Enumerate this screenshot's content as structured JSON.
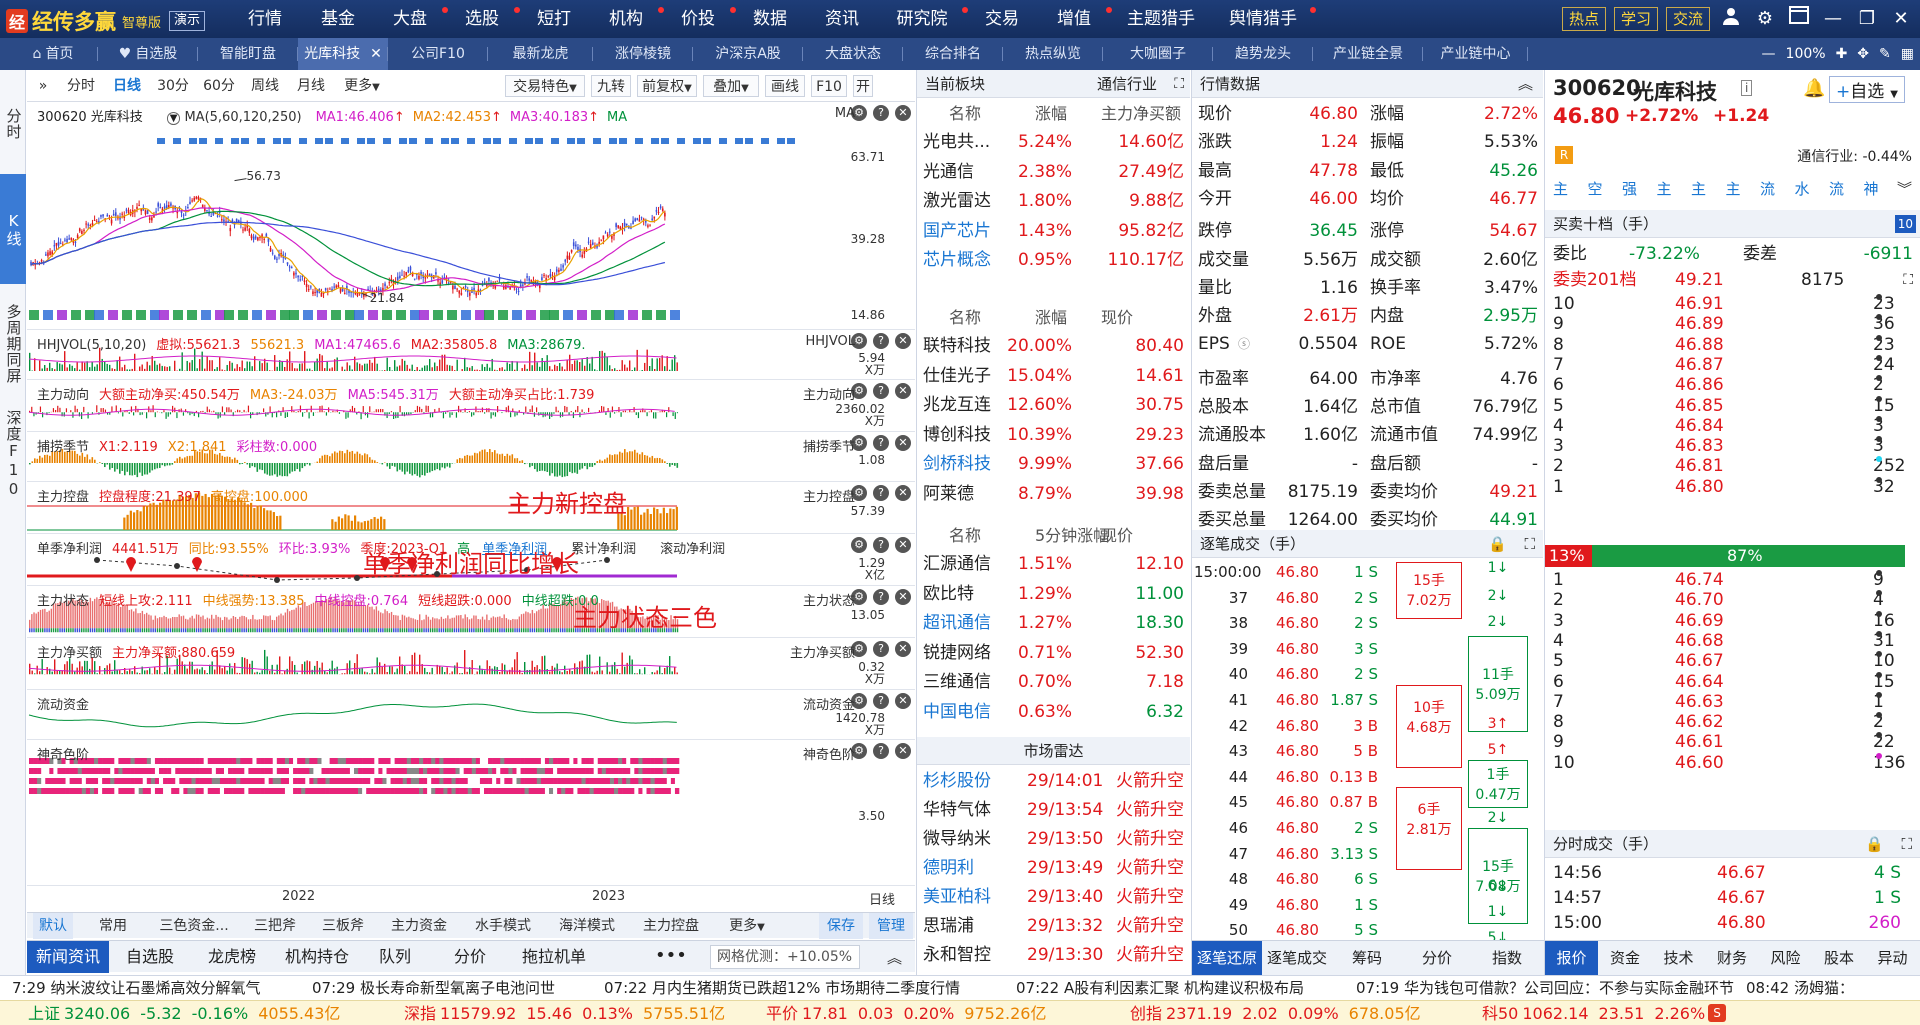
{
  "app": {
    "brand": "经传多赢",
    "edition": "智尊版",
    "demo": "演示"
  },
  "top_menu": [
    {
      "label": "行情",
      "dot": false
    },
    {
      "label": "基金",
      "dot": false
    },
    {
      "label": "大盘",
      "dot": true
    },
    {
      "label": "选股",
      "dot": true
    },
    {
      "label": "短打",
      "dot": false
    },
    {
      "label": "机构",
      "dot": true
    },
    {
      "label": "价投",
      "dot": true
    },
    {
      "label": "数据",
      "dot": false
    },
    {
      "label": "资讯",
      "dot": false
    },
    {
      "label": "研究院",
      "dot": true
    },
    {
      "label": "交易",
      "dot": false
    },
    {
      "label": "增值",
      "dot": true
    },
    {
      "label": "主题猎手",
      "dot": false
    },
    {
      "label": "舆情猎手",
      "dot": true
    }
  ],
  "top_buttons": [
    "热点",
    "学习",
    "交流"
  ],
  "tabs": [
    "首页",
    "自选股",
    "智能盯盘",
    "光库科技",
    "公司F10",
    "最新龙虎",
    "涨停棱镜",
    "沪深京A股",
    "大盘状态",
    "综合排名",
    "热点纵览",
    "大咖圈子",
    "趋势龙头",
    "产业链全景",
    "产业链中心"
  ],
  "zoom": "100%",
  "vtabs": [
    "分时",
    "K线",
    "多周期同屏",
    "深度F10"
  ],
  "chart_toolbar": {
    "periods": [
      "分时",
      "日线",
      "30分",
      "60分",
      "周线",
      "月线",
      "更多"
    ],
    "tools": [
      "交易特色",
      "九转",
      "前复权",
      "叠加",
      "画线",
      "F10",
      "开"
    ]
  },
  "panes": [
    {
      "name": "main",
      "code": "300620 光库科技",
      "ma_title": "MA(5,60,120,250)",
      "ma1": "MA1:46.406",
      "ma2": "MA2:42.453",
      "ma3": "MA3:40.183",
      "ma4": "MA",
      "right": "MA",
      "y": [
        "63.71",
        "39.28",
        "14.86"
      ],
      "high": "56.73",
      "low": "21.84"
    },
    {
      "name": "hhjvol",
      "title": "HHJVOL(5,10,20)",
      "v1": "虚拟:55621.3",
      "v2": "55621.3",
      "v3": "MA1:47465.6",
      "v4": "MA2:35805.8",
      "v5": "MA3:28679.",
      "right": "HHJVOL",
      "y1": "5.94",
      "y2": "X万"
    },
    {
      "name": "zldx",
      "title": "主力动向",
      "v1": "大额主动净买:450.54万",
      "v2": "MA3:-24.03万",
      "v3": "MA5:545.31万",
      "v4": "大额主动净买占比:1.739",
      "right": "主力动向",
      "y1": "2360.02",
      "y2": "X万"
    },
    {
      "name": "blj",
      "title": "捕捞季节",
      "v1": "X1:2.119",
      "v2": "X2:1.841",
      "v3": "彩柱数:0.000",
      "right": "捕捞季节",
      "y1": "1.08"
    },
    {
      "name": "zlkp",
      "title": "主力控盘",
      "v1": "控盘程度:21.397",
      "v2": "高控盘:100.000",
      "right": "主力控盘",
      "y1": "57.39",
      "annot": "主力新控盘"
    },
    {
      "name": "dj",
      "title": "单季净利润",
      "v1": "4441.51万",
      "v2": "同比:93.55%",
      "v3": "环比:3.93%",
      "v4": "季度:2023-Q1",
      "v5": "高",
      "t1": "单季净利润",
      "t2": "累计净利润",
      "t3": "滚动净利润",
      "y1": "1.29",
      "y2": "X亿",
      "annot": "单季净利润同比增长"
    },
    {
      "name": "zlzt",
      "title": "主力状态",
      "v1": "短线上攻:2.111",
      "v2": "中线强势:13.385",
      "v3": "中线控盘:0.764",
      "v4": "短线超跌:0.000",
      "v5": "中线超跌:0.0",
      "right": "主力状态",
      "y1": "13.05",
      "annot": "主力状态三色"
    },
    {
      "name": "zljme",
      "title": "主力净买额",
      "v1": "主力净买额:880.659",
      "right": "主力净买额",
      "y1": "0.32",
      "y2": "X万"
    },
    {
      "name": "ldzj",
      "title": "流动资金",
      "right": "流动资金",
      "y1": "1420.78",
      "y2": "X万"
    },
    {
      "name": "sqsj",
      "title": "神奇色阶",
      "right": "神奇色阶",
      "y1": "3.50"
    }
  ],
  "xaxis": [
    "2022",
    "2023",
    "日线"
  ],
  "bottom_tabs": [
    "默认",
    "常用",
    "三色资金...",
    "三把斧",
    "三板斧",
    "主力资金",
    "水手模式",
    "海洋模式",
    "主力控盘",
    "更多",
    "保存",
    "管理"
  ],
  "bottom_nav": [
    "新闻资讯",
    "自选股",
    "龙虎榜",
    "机构持仓",
    "队列",
    "分价",
    "拖拉机单"
  ],
  "net_opt": "网格优测：+10.05%",
  "sector": {
    "title": "当前板块",
    "industry": "通信行业",
    "h1": [
      "名称",
      "涨幅",
      "主力净买额"
    ],
    "list1": [
      {
        "n": "光电共...",
        "c": "5.24%",
        "v": "14.60亿",
        "blue": false
      },
      {
        "n": "光通信",
        "c": "2.38%",
        "v": "27.49亿",
        "blue": false
      },
      {
        "n": "激光雷达",
        "c": "1.80%",
        "v": "9.88亿",
        "blue": false
      },
      {
        "n": "国产芯片",
        "c": "1.43%",
        "v": "95.82亿",
        "blue": true
      },
      {
        "n": "芯片概念",
        "c": "0.95%",
        "v": "110.17亿",
        "blue": true
      }
    ],
    "h2": [
      "名称",
      "涨幅",
      "现价"
    ],
    "list2": [
      {
        "n": "联特科技",
        "c": "20.00%",
        "v": "80.40",
        "blue": false
      },
      {
        "n": "仕佳光子",
        "c": "15.04%",
        "v": "14.61",
        "blue": false
      },
      {
        "n": "兆龙互连",
        "c": "12.60%",
        "v": "30.75",
        "blue": false
      },
      {
        "n": "博创科技",
        "c": "10.39%",
        "v": "29.23",
        "blue": false
      },
      {
        "n": "剑桥科技",
        "c": "9.99%",
        "v": "37.66",
        "blue": true
      },
      {
        "n": "阿莱德",
        "c": "8.79%",
        "v": "39.98",
        "blue": false
      }
    ],
    "h3": [
      "名称",
      "5分钟涨幅",
      "现价"
    ],
    "list3": [
      {
        "n": "汇源通信",
        "c": "1.51%",
        "v": "12.10",
        "blue": false
      },
      {
        "n": "欧比特",
        "c": "1.29%",
        "v": "11.00",
        "blue": false
      },
      {
        "n": "超讯通信",
        "c": "1.27%",
        "v": "18.30",
        "blue": true
      },
      {
        "n": "锐捷网络",
        "c": "0.71%",
        "v": "52.30",
        "blue": false
      },
      {
        "n": "三维通信",
        "c": "0.70%",
        "v": "7.18",
        "blue": false
      },
      {
        "n": "中国电信",
        "c": "0.63%",
        "v": "6.32",
        "blue": true
      }
    ],
    "radar_title": "市场雷达",
    "radar": [
      {
        "n": "杉杉股份",
        "t": "29/14:01",
        "e": "火箭升空",
        "blue": true
      },
      {
        "n": "华特气体",
        "t": "29/13:54",
        "e": "火箭升空",
        "blue": false
      },
      {
        "n": "微导纳米",
        "t": "29/13:50",
        "e": "火箭升空",
        "blue": false
      },
      {
        "n": "德明利",
        "t": "29/13:49",
        "e": "火箭升空",
        "blue": true
      },
      {
        "n": "美亚柏科",
        "t": "29/13:40",
        "e": "火箭升空",
        "blue": true
      },
      {
        "n": "思瑞浦",
        "t": "29/13:32",
        "e": "火箭升空",
        "blue": false
      },
      {
        "n": "永和智控",
        "t": "29/13:30",
        "e": "火箭升空",
        "blue": false
      }
    ]
  },
  "market": {
    "title": "行情数据",
    "rows": [
      {
        "l1": "现价",
        "v1": "46.80",
        "c1": "red",
        "l2": "涨幅",
        "v2": "2.72%",
        "c2": "red"
      },
      {
        "l1": "涨跌",
        "v1": "1.24",
        "c1": "red",
        "l2": "振幅",
        "v2": "5.53%",
        "c2": ""
      },
      {
        "l1": "最高",
        "v1": "47.78",
        "c1": "red",
        "l2": "最低",
        "v2": "45.26",
        "c2": "grn"
      },
      {
        "l1": "今开",
        "v1": "46.00",
        "c1": "red",
        "l2": "均价",
        "v2": "46.77",
        "c2": "red"
      },
      {
        "l1": "跌停",
        "v1": "36.45",
        "c1": "grn",
        "l2": "涨停",
        "v2": "54.67",
        "c2": "red"
      },
      {
        "l1": "成交量",
        "v1": "5.56万",
        "c1": "",
        "l2": "成交额",
        "v2": "2.60亿",
        "c2": ""
      },
      {
        "l1": "量比",
        "v1": "1.16",
        "c1": "",
        "l2": "换手率",
        "v2": "3.47%",
        "c2": ""
      },
      {
        "l1": "外盘",
        "v1": "2.61万",
        "c1": "red",
        "l2": "内盘",
        "v2": "2.95万",
        "c2": "grn"
      },
      {
        "l1": "EPS",
        "v1": "0.5504",
        "c1": "",
        "l2": "ROE",
        "v2": "5.72%",
        "c2": ""
      },
      {
        "l1": "市盈率",
        "v1": "64.00",
        "c1": "",
        "l2": "市净率",
        "v2": "4.76",
        "c2": ""
      },
      {
        "l1": "总股本",
        "v1": "1.64亿",
        "c1": "",
        "l2": "总市值",
        "v2": "76.79亿",
        "c2": ""
      },
      {
        "l1": "流通股本",
        "v1": "1.60亿",
        "c1": "",
        "l2": "流通市值",
        "v2": "74.99亿",
        "c2": ""
      },
      {
        "l1": "盘后量",
        "v1": "-",
        "c1": "",
        "l2": "盘后额",
        "v2": "-",
        "c2": ""
      },
      {
        "l1": "委卖总量",
        "v1": "8175.19",
        "c1": "",
        "l2": "委卖均价",
        "v2": "49.21",
        "c2": "red"
      },
      {
        "l1": "委买总量",
        "v1": "1264.00",
        "c1": "",
        "l2": "委买均价",
        "v2": "44.91",
        "c2": "grn"
      }
    ],
    "ticks_title": "逐笔成交（手）",
    "ticks": [
      {
        "t": "15:00:00",
        "p": "46.80",
        "v": "1 S"
      },
      {
        "t": "37",
        "p": "46.80",
        "v": "2 S"
      },
      {
        "t": "38",
        "p": "46.80",
        "v": "2 S"
      },
      {
        "t": "39",
        "p": "46.80",
        "v": "3 S"
      },
      {
        "t": "40",
        "p": "46.80",
        "v": "2 S"
      },
      {
        "t": "41",
        "p": "46.80",
        "v": "1.87 S"
      },
      {
        "t": "42",
        "p": "46.80",
        "v": "3 B"
      },
      {
        "t": "43",
        "p": "46.80",
        "v": "5 B"
      },
      {
        "t": "44",
        "p": "46.80",
        "v": "0.13 B"
      },
      {
        "t": "45",
        "p": "46.80",
        "v": "0.87 B"
      },
      {
        "t": "46",
        "p": "46.80",
        "v": "2 S"
      },
      {
        "t": "47",
        "p": "46.80",
        "v": "3.13 S"
      },
      {
        "t": "48",
        "p": "46.80",
        "v": "6 S"
      },
      {
        "t": "49",
        "p": "46.80",
        "v": "1 S"
      },
      {
        "t": "50",
        "p": "46.80",
        "v": "5 S"
      }
    ],
    "boxes_left": [
      {
        "a": "15手",
        "b": "7.02万"
      },
      {
        "a": "10手",
        "b": "4.68万"
      },
      {
        "a": "6手",
        "b": "2.81万"
      }
    ],
    "boxes_right": [
      {
        "a": "1",
        "c": "grn"
      },
      {
        "a": "2",
        "c": "grn"
      },
      {
        "a": "2",
        "c": "grn"
      },
      {
        "a": "11手",
        "b": "5.09万",
        "c": "grn"
      },
      {
        "a": "3",
        "c": "red"
      },
      {
        "a": "5",
        "c": "red"
      },
      {
        "a": "1手",
        "b": "0.47万",
        "c": "grn"
      },
      {
        "a": "2",
        "c": "grn"
      },
      {
        "a": "15手",
        "b": "7.08万",
        "c": "grn"
      },
      {
        "a": "6",
        "c": "grn"
      },
      {
        "a": "1",
        "c": "grn"
      },
      {
        "a": "5",
        "c": "grn"
      }
    ],
    "nav": [
      "逐笔还原",
      "逐笔成交",
      "筹码",
      "分价",
      "指数"
    ]
  },
  "book": {
    "code": "300620",
    "name": "光库科技",
    "price": "46.80",
    "pct": "+2.72%",
    "chg": "+1.24",
    "industry": "通信行业: -0.44%",
    "add": "自选",
    "signals": [
      "主",
      "空",
      "强",
      "主",
      "主",
      "主",
      "流",
      "水",
      "流",
      "神"
    ],
    "title": "买卖十档（手）",
    "badge": "10",
    "wb_l": "委比",
    "wb": "-73.22%",
    "wc_l": "委差",
    "wc": "-6911",
    "sell201_l": "委卖201档",
    "sell201_p": "49.21",
    "sell201_v": "8175",
    "asks": [
      {
        "n": "10",
        "p": "46.91",
        "v": "23",
        "d": "#333"
      },
      {
        "n": "9",
        "p": "46.89",
        "v": "36",
        "d": "#333"
      },
      {
        "n": "8",
        "p": "46.88",
        "v": "23",
        "d": "#333"
      },
      {
        "n": "7",
        "p": "46.87",
        "v": "24",
        "d": "#333"
      },
      {
        "n": "6",
        "p": "46.86",
        "v": "2",
        "d": "#333"
      },
      {
        "n": "5",
        "p": "46.85",
        "v": "15",
        "d": "#333"
      },
      {
        "n": "4",
        "p": "46.84",
        "v": "3",
        "d": "#333"
      },
      {
        "n": "3",
        "p": "46.83",
        "v": "3",
        "d": "#333"
      },
      {
        "n": "2",
        "p": "46.81",
        "v": "252",
        "d": "#21d4f0"
      },
      {
        "n": "1",
        "p": "46.80",
        "v": "32",
        "d": "#333"
      }
    ],
    "ratio_sell": "13%",
    "ratio_buy": "87%",
    "ratio_sell_frac": 0.13,
    "bids": [
      {
        "n": "1",
        "p": "46.74",
        "v": "9",
        "d": "#333"
      },
      {
        "n": "2",
        "p": "46.70",
        "v": "4",
        "d": "#333"
      },
      {
        "n": "3",
        "p": "46.69",
        "v": "16",
        "d": "#333"
      },
      {
        "n": "4",
        "p": "46.68",
        "v": "31",
        "d": "#333"
      },
      {
        "n": "5",
        "p": "46.67",
        "v": "10",
        "d": "#333"
      },
      {
        "n": "6",
        "p": "46.64",
        "v": "15",
        "d": "#333"
      },
      {
        "n": "7",
        "p": "46.63",
        "v": "1",
        "d": "#333"
      },
      {
        "n": "8",
        "p": "46.62",
        "v": "2",
        "d": "#333"
      },
      {
        "n": "9",
        "p": "46.61",
        "v": "22",
        "d": "#333"
      },
      {
        "n": "10",
        "p": "46.60",
        "v": "136",
        "d": "#d21ec8"
      }
    ],
    "time_title": "分时成交（手）",
    "time": [
      {
        "t": "14:56",
        "p": "46.67",
        "v": "4 S"
      },
      {
        "t": "14:57",
        "p": "46.67",
        "v": "1 S"
      },
      {
        "t": "15:00",
        "p": "46.80",
        "v": "260"
      }
    ],
    "nav": [
      "报价",
      "资金",
      "技术",
      "财务",
      "风险",
      "股本",
      "异动"
    ]
  },
  "news": [
    "7:29 纳米波纹让石墨烯高效分解氧气",
    "07:29 极长寿命新型氧离子电池问世",
    "07:22 月内生猪期货已跌超12% 市场期待二季度行情",
    "07:22 A股有利因素汇聚 机构建议积极布局",
    "07:19 华为钱包可借款？公司回应：不参与实际金融环节",
    "08:42 汤姆猫："
  ],
  "indices": [
    {
      "n": "上证",
      "v": "3240.06",
      "c": "-5.32",
      "p": "-0.16%",
      "a": "4055.43亿",
      "col": "grn"
    },
    {
      "n": "深指",
      "v": "11579.92",
      "c": "15.46",
      "p": "0.13%",
      "a": "5755.51亿",
      "col": "red"
    },
    {
      "n": "平价",
      "v": "17.81",
      "c": "0.03",
      "p": "0.20%",
      "a": "9752.26亿",
      "col": "red"
    },
    {
      "n": "创指",
      "v": "2371.19",
      "c": "2.02",
      "p": "0.09%",
      "a": "678.05亿",
      "col": "red"
    },
    {
      "n": "科50",
      "v": "1062.14",
      "c": "23.51",
      "p": "2.26%",
      "a": "",
      "col": "red"
    }
  ],
  "colors": {
    "up": "#e0191c",
    "down": "#00913a",
    "accent": "#1d5bbf"
  }
}
